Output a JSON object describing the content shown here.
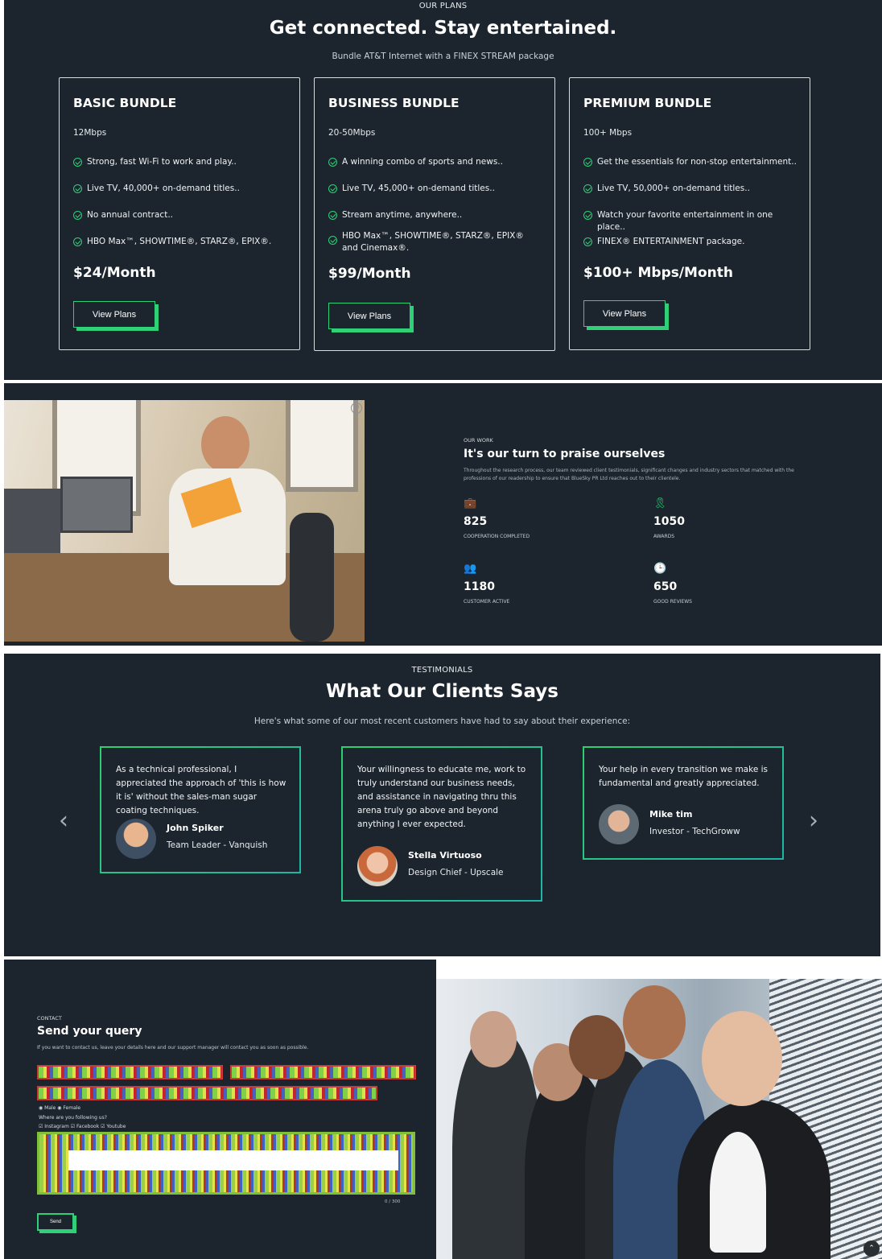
{
  "plans": {
    "eyebrow": "OUR PLANS",
    "title": "Get connected. Stay entertained.",
    "subtitle": "Bundle AT&T Internet with a FINEX STREAM package",
    "cards": [
      {
        "name": "BASIC BUNDLE",
        "speed": "12Mbps",
        "features": [
          "Strong, fast Wi-Fi to work and play..",
          "Live TV, 40,000+ on-demand titles..",
          "No annual contract..",
          "HBO Max™, SHOWTIME®, STARZ®, EPIX®."
        ],
        "price": "$24/Month",
        "button": "View Plans"
      },
      {
        "name": "BUSINESS BUNDLE",
        "speed": "20-50Mbps",
        "features": [
          "A winning combo of sports and news..",
          "Live TV, 45,000+ on-demand titles..",
          "Stream anytime, anywhere..",
          "HBO Max™, SHOWTIME®, STARZ®, EPIX® and Cinemax®."
        ],
        "price": "$99/Month",
        "button": "View Plans"
      },
      {
        "name": "PREMIUM BUNDLE",
        "speed": "100+ Mbps",
        "features": [
          "Get the essentials for non-stop entertainment..",
          "Live TV, 50,000+ on-demand titles..",
          "Watch your favorite entertainment in one place..",
          "FINEX® ENTERTAINMENT package."
        ],
        "price": "$100+ Mbps/Month",
        "button": "View Plans"
      }
    ]
  },
  "work": {
    "eyebrow": "OUR WORK",
    "title": "It's our turn to praise ourselves",
    "description": "Throughout the research process, our team reviewed client testimonials, significant changes and industry sectors that matched with the professions of our readership to ensure that BlueSky PR Ltd reaches out to their clientele.",
    "close_glyph": "⊗",
    "stats": [
      {
        "icon": "briefcase-icon",
        "glyph": "💼",
        "value": "825",
        "label": "COOPERATION COMPLETED"
      },
      {
        "icon": "award-icon",
        "glyph": "🎗",
        "value": "1050",
        "label": "AWARDS"
      },
      {
        "icon": "users-icon",
        "glyph": "👥",
        "value": "1180",
        "label": "CUSTOMER ACTIVE"
      },
      {
        "icon": "clock-icon",
        "glyph": "🕒",
        "value": "650",
        "label": "GOOD REVIEWS"
      }
    ]
  },
  "testimonials": {
    "eyebrow": "TESTIMONIALS",
    "title": "What Our Clients Says",
    "subtitle": "Here's what some of our most recent customers have had to say about their experience:",
    "prev_glyph": "‹",
    "next_glyph": "›",
    "items": [
      {
        "quote": "As a technical professional, I appreciated the approach of 'this is how it is' without the sales-man sugar coating techniques.",
        "name": "John Spiker",
        "role": "Team Leader - Vanquish"
      },
      {
        "quote": "Your willingness to educate me, work to truly understand our business needs, and assistance in navigating thru this arena truly go above and beyond anything I ever expected.",
        "name": "Stella Virtuoso",
        "role": "Design Chief - Upscale"
      },
      {
        "quote": "Your help in every transition we make is fundamental and greatly appreciated.",
        "name": "Mike tim",
        "role": "Investor - TechGroww"
      }
    ]
  },
  "contact": {
    "eyebrow": "CONTACT",
    "title": "Send your query",
    "description": "If you want to contact us, leave your details here and our support manager will contact you as soon as possible.",
    "gender_line": "◉ Male ◉ Female",
    "follow_question": "Where are you following us?",
    "follow_options": "☑ Instagram ☑ Facebook ☑ Youtube",
    "char_count": "0 / 300",
    "send_label": "Send",
    "scroll_top_glyph": "⌃"
  },
  "colors": {
    "background": "#1c252d",
    "accent": "#2fd078",
    "card_border": "#d8dde1"
  }
}
